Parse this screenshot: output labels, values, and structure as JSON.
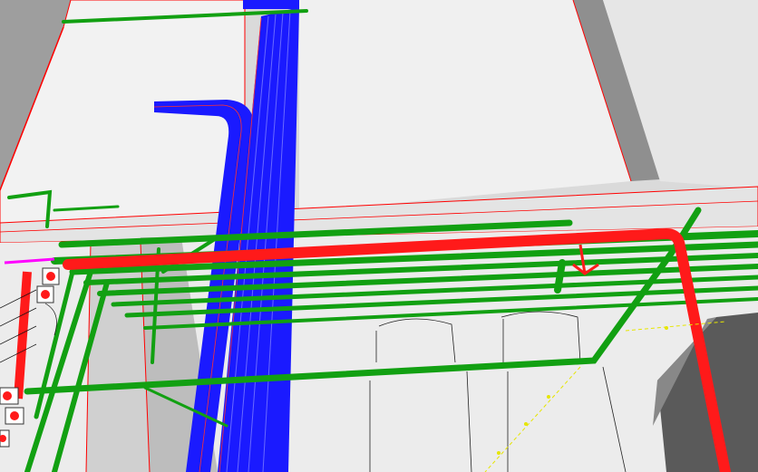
{
  "viewport": {
    "background": "#dcdcdc",
    "wall_color": "#efefef",
    "edge_color": "#ff0000"
  },
  "pipe_colors": {
    "green": "#12a012",
    "red": "#ff1a1a",
    "blue": "#1a1aff",
    "yellow_marker": "#e6e600",
    "magenta": "#ff00ff"
  },
  "labels": {
    "valve_markers": "valve-markers"
  }
}
